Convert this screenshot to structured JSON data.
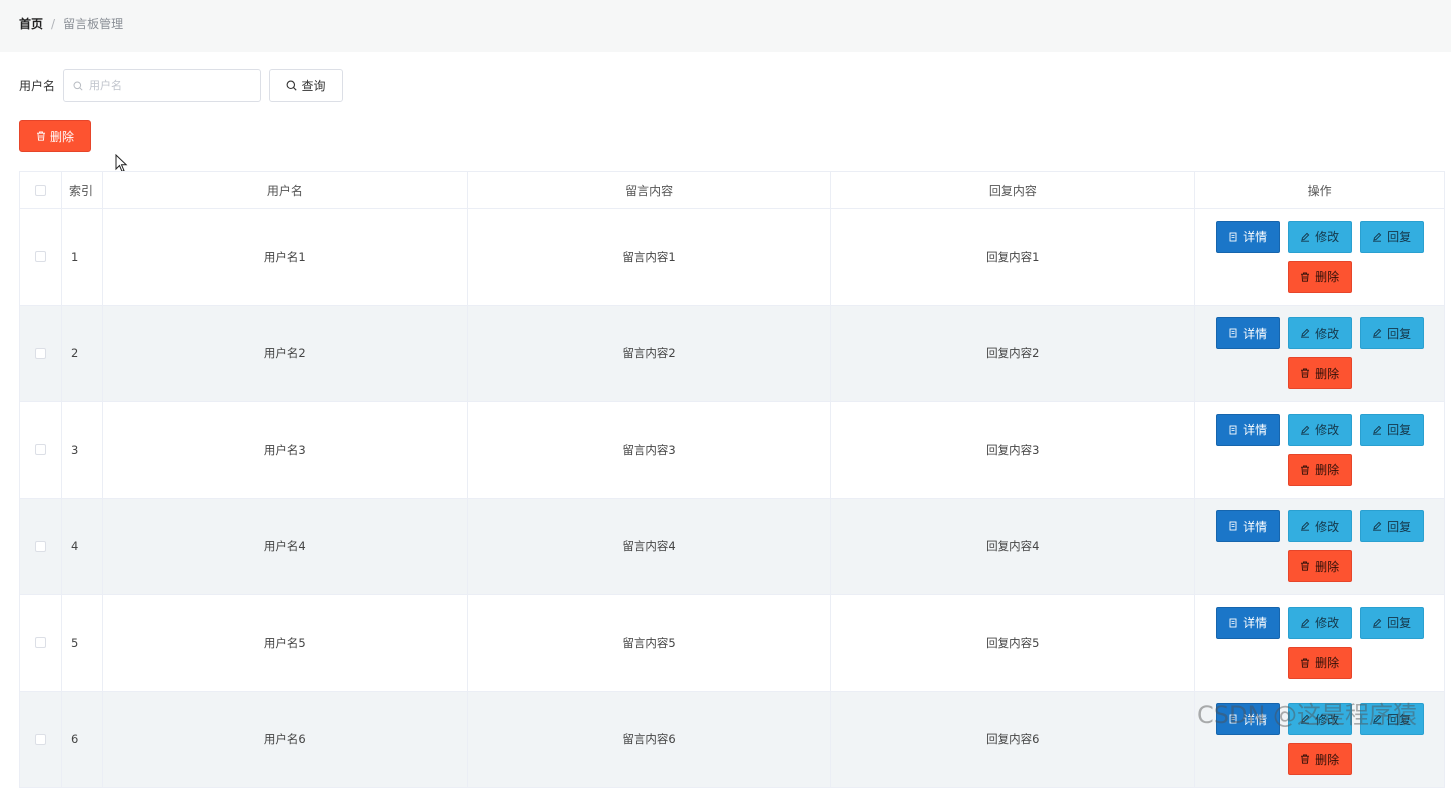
{
  "breadcrumb": {
    "home": "首页",
    "separator": "/",
    "current": "留言板管理"
  },
  "search": {
    "label": "用户名",
    "placeholder": "用户名",
    "value": "",
    "query_label": "查询"
  },
  "toolbar": {
    "delete_label": "删除"
  },
  "table": {
    "columns": [
      "索引",
      "用户名",
      "留言内容",
      "回复内容",
      "操作"
    ],
    "rows": [
      {
        "index": "1",
        "username": "用户名1",
        "content": "留言内容1",
        "reply": "回复内容1"
      },
      {
        "index": "2",
        "username": "用户名2",
        "content": "留言内容2",
        "reply": "回复内容2"
      },
      {
        "index": "3",
        "username": "用户名3",
        "content": "留言内容3",
        "reply": "回复内容3"
      },
      {
        "index": "4",
        "username": "用户名4",
        "content": "留言内容4",
        "reply": "回复内容4"
      },
      {
        "index": "5",
        "username": "用户名5",
        "content": "留言内容5",
        "reply": "回复内容5"
      },
      {
        "index": "6",
        "username": "用户名6",
        "content": "留言内容6",
        "reply": "回复内容6"
      }
    ],
    "actions": {
      "detail": "详情",
      "edit": "修改",
      "reply": "回复",
      "delete": "删除"
    }
  },
  "colors": {
    "danger": "#fd5330",
    "primary": "#1b76c8",
    "info": "#33aee0",
    "stripe": "#f1f4f6"
  },
  "watermark": "CSDN @这是程序猿"
}
